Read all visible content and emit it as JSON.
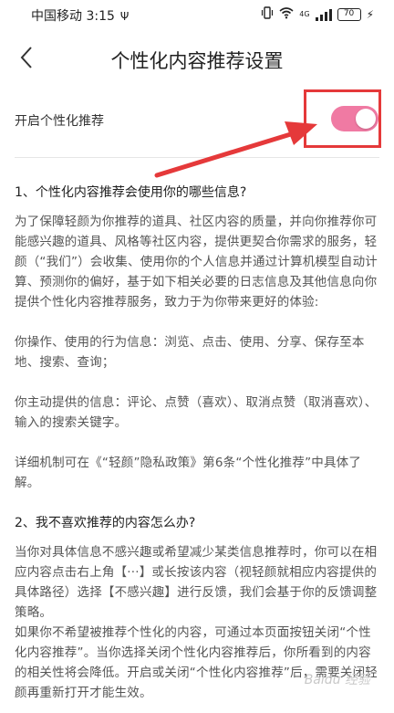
{
  "status_bar": {
    "carrier_time": "中国移动 3:15",
    "usb_glyph": "Ψ",
    "network": "4G",
    "battery": "70",
    "bolt_glyph": "⚡"
  },
  "header": {
    "title": "个性化内容推荐设置"
  },
  "setting": {
    "label": "开启个性化推荐",
    "enabled": true
  },
  "content": {
    "section1_heading": "1、个性化内容推荐会使用你的哪些信息?",
    "section1_paragraphs": [
      "为了保障轻颜为你推荐的道具、社区内容的质量，并向你推荐你可能感兴趣的道具、风格等社区内容，提供更契合你需求的服务，轻颜（“我们”）会收集、使用你的个人信息并通过计算机模型自动计算、预测你的偏好，基于如下相关必要的日志信息及其他信息向你提供个性化内容推荐服务，致力于为你带来更好的体验:",
      "你操作、使用的行为信息：浏览、点击、使用、分享、保存至本地、搜索、查询；",
      "你主动提供的信息：评论、点赞（喜欢）、取消点赞（取消喜欢）、输入的搜索关键字。",
      "详细机制可在《“轻颜”隐私政策》第6条“个性化推荐”中具体了解。"
    ],
    "section2_heading": "2、我不喜欢推荐的内容怎么办?",
    "section2_paragraphs": [
      "当你对具体信息不感兴趣或希望减少某类信息推荐时，你可以在相应内容点击右上角【···】或长按该内容（视轻颜就相应内容提供的具体路径）选择【不感兴趣】进行反馈，我们会基于你的反馈调整策略。",
      "如果你不希望被推荐个性化的内容，可通过本页面按钮关闭“个性化内容推荐”。当你选择关闭个性化内容推荐后，你所看到的内容的相关性将会降低。开启或关闭“个性化内容推荐”后，需要关闭轻颜再重新打开才能生效。"
    ]
  },
  "watermark": "Baidu 经验",
  "colors": {
    "switch_on": "#f07aa3",
    "annotation_red": "#e5393a"
  }
}
